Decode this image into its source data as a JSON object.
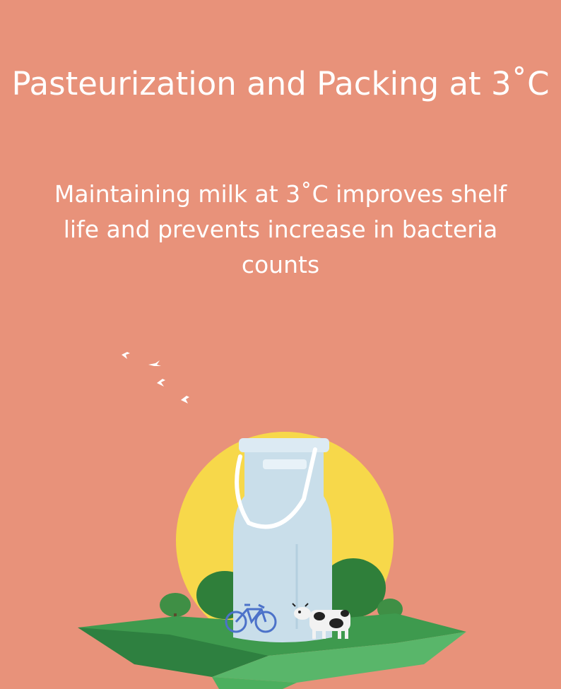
{
  "title": "Pasteurization and Packing at 3˚C",
  "subtitle": "Maintaining milk at 3˚C improves shelf life and prevents increase in bacteria counts",
  "illustration": {
    "icons": [
      "birds-icon",
      "sun-icon",
      "milk-can-icon",
      "bicycle-icon",
      "cow-icon",
      "tree-icon",
      "grass-field-icon"
    ]
  },
  "colors": {
    "background": "#E8927A",
    "sun": "#F7D84A",
    "milk_can": "#C9DEEA",
    "field": "#3E9A4E",
    "trees": "#3F8F45"
  }
}
